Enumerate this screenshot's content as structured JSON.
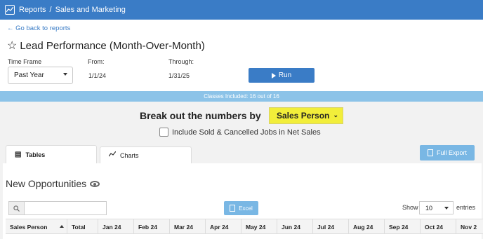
{
  "header": {
    "crumb_root": "Reports",
    "crumb_sep": "/",
    "crumb_current": "Sales and Marketing"
  },
  "back_link": "← Go back to reports",
  "page_title": "Lead Performance (Month-Over-Month)",
  "filters": {
    "timeframe_label": "Time Frame",
    "timeframe_value": "Past Year",
    "from_label": "From:",
    "from_value": "1/1/24",
    "through_label": "Through:",
    "through_value": "1/31/25",
    "run_label": "Run"
  },
  "classes_bar": "Classes Included: 16 out of 16",
  "breakout": {
    "label": "Break out the numbers by",
    "value": "Sales Person"
  },
  "include_sold_label": "Include Sold & Cancelled Jobs in Net Sales",
  "tabs": [
    {
      "label": "Tables"
    },
    {
      "label": "Charts"
    }
  ],
  "full_export_label": "Full Export",
  "section_title": "New Opportunities",
  "excel_label": "Excel",
  "show_label": "Show",
  "entries_value": "10",
  "entries_label": "entries",
  "table": {
    "columns": [
      "Sales Person",
      "Total",
      "Jan 24",
      "Feb 24",
      "Mar 24",
      "Apr 24",
      "May 24",
      "Jun 24",
      "Jul 24",
      "Aug 24",
      "Sep 24",
      "Oct 24",
      "Nov 2"
    ]
  },
  "colors": {
    "topbar": "#3a7cc6",
    "classes_bar": "#8cc3e8",
    "breakout_highlight": "#f2ee3a",
    "secondary_button": "#79b7e4"
  },
  "icons": [
    "line-chart-icon",
    "star-outline-icon",
    "play-icon",
    "table-icon",
    "chart-icon",
    "file-excel-icon",
    "eye-icon",
    "search-icon",
    "sort-asc-icon"
  ]
}
